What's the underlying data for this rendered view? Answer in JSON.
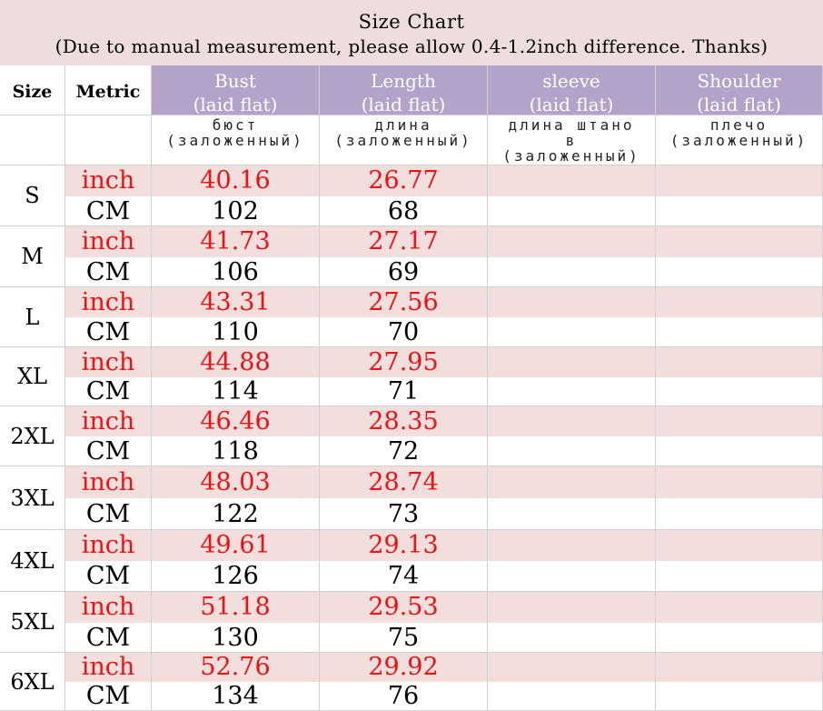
{
  "title": {
    "line1": "Size Chart",
    "line2": "(Due to manual measurement, please allow 0.4-1.2inch difference. Thanks)"
  },
  "header": {
    "size_label": "Size",
    "metric_label": "Metric",
    "columns": [
      {
        "name": "Bust",
        "sub": "(laid flat)",
        "ru": "бюст\n(заложенный)"
      },
      {
        "name": "Length",
        "sub": "(laid flat)",
        "ru": "длина\n(заложенный)"
      },
      {
        "name": "sleeve",
        "sub": "(laid flat)",
        "ru": "длина штано\nв\n(заложенный)"
      },
      {
        "name": "Shoulder",
        "sub": "(laid flat)",
        "ru": "плечо\n(заложенный)"
      }
    ]
  },
  "colors": {
    "title_bg": "#eedddd",
    "header_bg": "#b3a3c9",
    "inch_row_bg": "#f3dede",
    "inch_text": "#ee1111"
  },
  "sizes": [
    {
      "size": "S",
      "inch_label": "inch",
      "cm_label": "CM",
      "inch": [
        "40.16",
        "26.77",
        "",
        ""
      ],
      "cm": [
        "102",
        "68",
        "",
        ""
      ]
    },
    {
      "size": "M",
      "inch_label": "inch",
      "cm_label": "CM",
      "inch": [
        "41.73",
        "27.17",
        "",
        ""
      ],
      "cm": [
        "106",
        "69",
        "",
        ""
      ]
    },
    {
      "size": "L",
      "inch_label": "inch",
      "cm_label": "CM",
      "inch": [
        "43.31",
        "27.56",
        "",
        ""
      ],
      "cm": [
        "110",
        "70",
        "",
        ""
      ]
    },
    {
      "size": "XL",
      "inch_label": "inch",
      "cm_label": "CM",
      "inch": [
        "44.88",
        "27.95",
        "",
        ""
      ],
      "cm": [
        "114",
        "71",
        "",
        ""
      ]
    },
    {
      "size": "2XL",
      "inch_label": "inch",
      "cm_label": "CM",
      "inch": [
        "46.46",
        "28.35",
        "",
        ""
      ],
      "cm": [
        "118",
        "72",
        "",
        ""
      ]
    },
    {
      "size": "3XL",
      "inch_label": "inch",
      "cm_label": "CM",
      "inch": [
        "48.03",
        "28.74",
        "",
        ""
      ],
      "cm": [
        "122",
        "73",
        "",
        ""
      ]
    },
    {
      "size": "4XL",
      "inch_label": "inch",
      "cm_label": "CM",
      "inch": [
        "49.61",
        "29.13",
        "",
        ""
      ],
      "cm": [
        "126",
        "74",
        "",
        ""
      ]
    },
    {
      "size": "5XL",
      "inch_label": "inch",
      "cm_label": "CM",
      "inch": [
        "51.18",
        "29.53",
        "",
        ""
      ],
      "cm": [
        "130",
        "75",
        "",
        ""
      ]
    },
    {
      "size": "6XL",
      "inch_label": "inch",
      "cm_label": "CM",
      "inch": [
        "52.76",
        "29.92",
        "",
        ""
      ],
      "cm": [
        "134",
        "76",
        "",
        ""
      ]
    }
  ]
}
